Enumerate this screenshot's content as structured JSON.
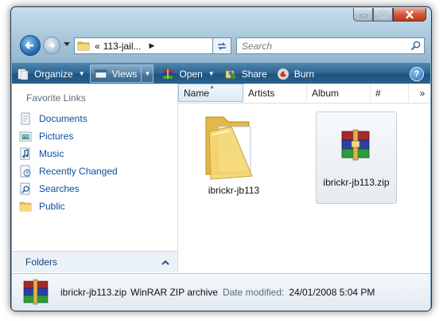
{
  "address": {
    "path": "113-jail...",
    "prefix": "«"
  },
  "search": {
    "placeholder": "Search"
  },
  "toolbar": {
    "organize": "Organize",
    "views": "Views",
    "open": "Open",
    "share": "Share",
    "burn": "Burn",
    "help": "?"
  },
  "favorites": {
    "title": "Favorite Links",
    "items": [
      {
        "label": "Documents",
        "icon": "documents-icon"
      },
      {
        "label": "Pictures",
        "icon": "pictures-icon"
      },
      {
        "label": "Music",
        "icon": "music-icon"
      },
      {
        "label": "Recently Changed",
        "icon": "recently-changed-icon"
      },
      {
        "label": "Searches",
        "icon": "searches-icon"
      },
      {
        "label": "Public",
        "icon": "public-icon"
      }
    ]
  },
  "folders": {
    "label": "Folders"
  },
  "columns": {
    "name": "Name",
    "artists": "Artists",
    "album": "Album",
    "track": "#",
    "more": "»"
  },
  "files": [
    {
      "name": "ibrickr-jb113",
      "type": "folder"
    },
    {
      "name": "ibrickr-jb113.zip",
      "type": "winrar-archive"
    }
  ],
  "details": {
    "name": "ibrickr-jb113.zip",
    "type": "WinRAR ZIP archive",
    "date_key": "Date modified:",
    "date_value": "24/01/2008 5:04 PM"
  },
  "colors": {
    "link": "#0b4ea2",
    "toolbar": "#2d6491",
    "close": "#c2381d"
  }
}
